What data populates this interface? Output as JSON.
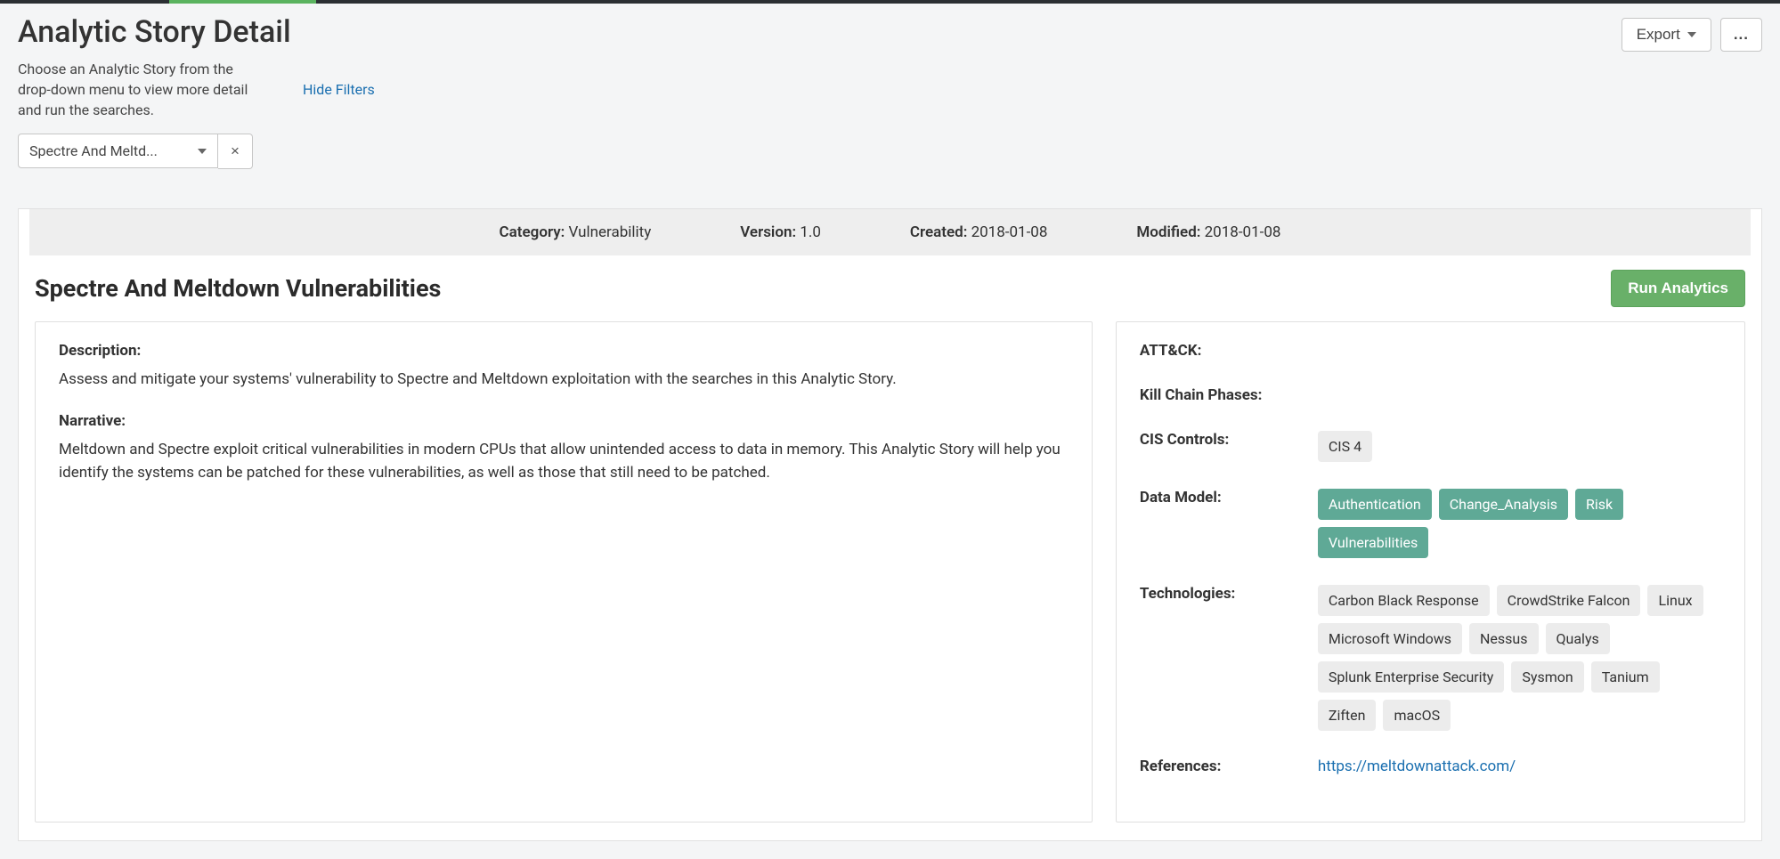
{
  "header": {
    "title": "Analytic Story Detail",
    "subtitle": "Choose an Analytic Story from the drop-down menu to view more detail and run the searches.",
    "hide_filters": "Hide Filters",
    "export_label": "Export",
    "more_label": "..."
  },
  "filter": {
    "selected": "Spectre And Meltd...",
    "clear": "×"
  },
  "meta": {
    "category_label": "Category:",
    "category_value": "Vulnerability",
    "version_label": "Version:",
    "version_value": "1.0",
    "created_label": "Created:",
    "created_value": "2018-01-08",
    "modified_label": "Modified:",
    "modified_value": "2018-01-08"
  },
  "story": {
    "title": "Spectre And Meltdown Vulnerabilities",
    "run_label": "Run Analytics"
  },
  "description": {
    "label": "Description:",
    "text": "Assess and mitigate your systems' vulnerability to Spectre and Meltdown exploitation with the searches in this Analytic Story."
  },
  "narrative": {
    "label": "Narrative:",
    "text": "Meltdown and Spectre exploit critical vulnerabilities in modern CPUs that allow unintended access to data in memory. This Analytic Story will help you identify the systems can be patched for these vulnerabilities, as well as those that still need to be patched."
  },
  "right": {
    "attck_label": "ATT&CK:",
    "kill_chain_label": "Kill Chain Phases:",
    "cis_label": "CIS Controls:",
    "cis_tags": [
      "CIS 4"
    ],
    "data_model_label": "Data Model:",
    "data_model_tags": [
      "Authentication",
      "Change_Analysis",
      "Risk",
      "Vulnerabilities"
    ],
    "tech_label": "Technologies:",
    "tech_tags": [
      "Carbon Black Response",
      "CrowdStrike Falcon",
      "Linux",
      "Microsoft Windows",
      "Nessus",
      "Qualys",
      "Splunk Enterprise Security",
      "Sysmon",
      "Tanium",
      "Ziften",
      "macOS"
    ],
    "references_label": "References:",
    "references_link": "https://meltdownattack.com/"
  }
}
